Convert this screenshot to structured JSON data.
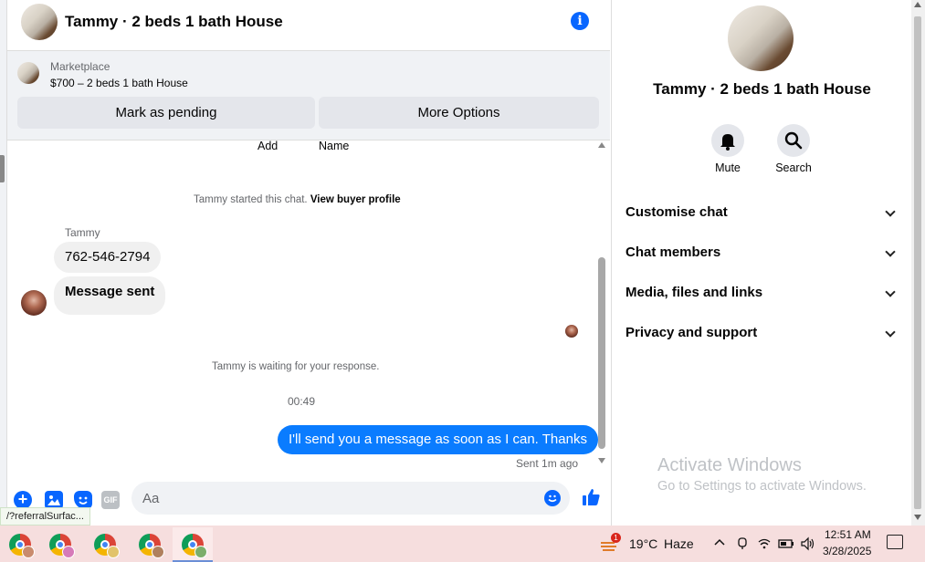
{
  "header": {
    "title": "Tammy · 2 beds 1 bath House",
    "info_icon": "info-icon"
  },
  "marketplace": {
    "label": "Marketplace",
    "listing": "$700 – 2 beds 1 bath House",
    "pending_button": "Mark as pending",
    "more_button": "More Options"
  },
  "chat": {
    "partial_add": "Add",
    "partial_name": "Name",
    "started_text": "Tammy started this chat. ",
    "view_profile": "View buyer profile",
    "sender_name": "Tammy",
    "incoming": [
      "762-546-2794",
      "Message sent"
    ],
    "waiting_text": "Tammy is waiting for your response.",
    "timestamp": "00:49",
    "outgoing": "I'll send you a message as soon as I can. Thanks",
    "sent_status": "Sent 1m ago"
  },
  "composer": {
    "placeholder": "Aa",
    "gif_label": "GIF",
    "plus_label": "+"
  },
  "status_url": "/?referralSurfac...",
  "right_panel": {
    "title": "Tammy · 2 beds 1 bath House",
    "mute_label": "Mute",
    "search_label": "Search",
    "sections": [
      "Customise chat",
      "Chat members",
      "Media, files and links",
      "Privacy and support"
    ],
    "watermark_title": "Activate Windows",
    "watermark_sub": "Go to Settings to activate Windows."
  },
  "taskbar": {
    "weather_badge": "1",
    "temperature": "19°C",
    "condition": "Haze",
    "time": "12:51 AM",
    "date": "3/28/2025"
  },
  "colors": {
    "accent": "#0866ff",
    "outgoing_bubble": "#0a7cff",
    "taskbar": "#f6dede"
  }
}
